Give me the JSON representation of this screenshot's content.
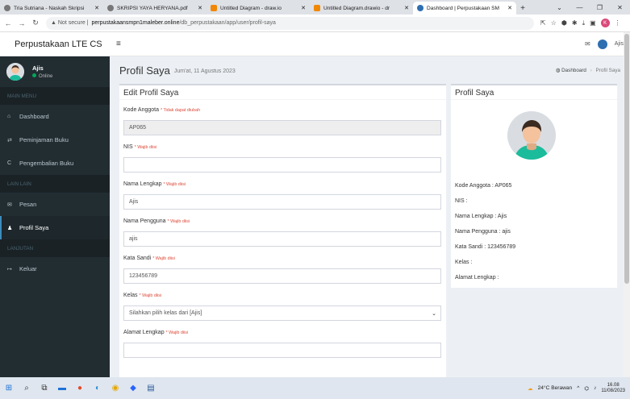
{
  "browser": {
    "tabs": [
      {
        "title": "Tria Sutriana - Naskah Skripsi",
        "color": "#555"
      },
      {
        "title": "SKRIPSI YAYA HERYANA.pdf",
        "color": "#555"
      },
      {
        "title": "Untitled Diagram - draw.io",
        "color": "#f08705"
      },
      {
        "title": "Untitled Diagram.drawio - dr",
        "color": "#f08705"
      },
      {
        "title": "Dashboard | Perpustakaan SM",
        "color": "#2d6fb0"
      }
    ],
    "url_prefix": "Not secure",
    "url_domain": "perpustakaansmpn1maleber.online",
    "url_path": "/db_perpustakaan/app/user/profil-saya"
  },
  "sidebar": {
    "logo": "Perpustakaan LTE CS",
    "user_name": "Ajis",
    "user_status": "Online",
    "header_main": "MAIN MENU",
    "header_lain": "LAIN LAIN",
    "header_lanjutan": "LANJUTAN",
    "items": {
      "dashboard": "Dashboard",
      "peminjaman": "Peminjaman Buku",
      "pengembalian": "Pengembalian Buku",
      "pesan": "Pesan",
      "profil": "Profil Saya",
      "keluar": "Keluar"
    }
  },
  "topbar": {
    "user": "Ajis"
  },
  "content": {
    "title": "Profil Saya",
    "date": "Jum'at, 11 Agustus 2023",
    "breadcrumb": [
      "Dashboard",
      "Profil Saya"
    ]
  },
  "form": {
    "title": "Edit Profil Saya",
    "fields": [
      {
        "label": "Kode Anggota",
        "note": "* Tidak dapat diubah",
        "value": ""
      },
      {
        "label": "NIS",
        "note": "* Wajib diisi",
        "value": ""
      },
      {
        "label": "Nama Lengkap",
        "note": "* Wajib diisi",
        "value": "Ajis"
      },
      {
        "label": "Nama Pengguna",
        "note": "* Wajib diisi",
        "value": "ajis"
      },
      {
        "label": "Kata Sandi",
        "note": "* Wajib diisi",
        "value": "123456789"
      },
      {
        "label": "Kelas",
        "note": "* Wajib diisi",
        "value": "Silahkan pilih kelas dari [Ajis]"
      },
      {
        "label": "Alamat Lengkap",
        "note": "* Wajib diisi",
        "value": ""
      }
    ],
    "kode_value": "AP065"
  },
  "profile": {
    "title": "Profil Saya",
    "lines": [
      "Kode Anggota : AP065",
      "NIS :",
      "Nama Lengkap : Ajis",
      "Nama Pengguna : ajis",
      "Kata Sandi : 123456789",
      "Kelas :",
      "Alamat Lengkap :"
    ]
  },
  "taskbar": {
    "weather": "24°C Berawan",
    "time": "16.08",
    "date": "11/08/2023"
  }
}
